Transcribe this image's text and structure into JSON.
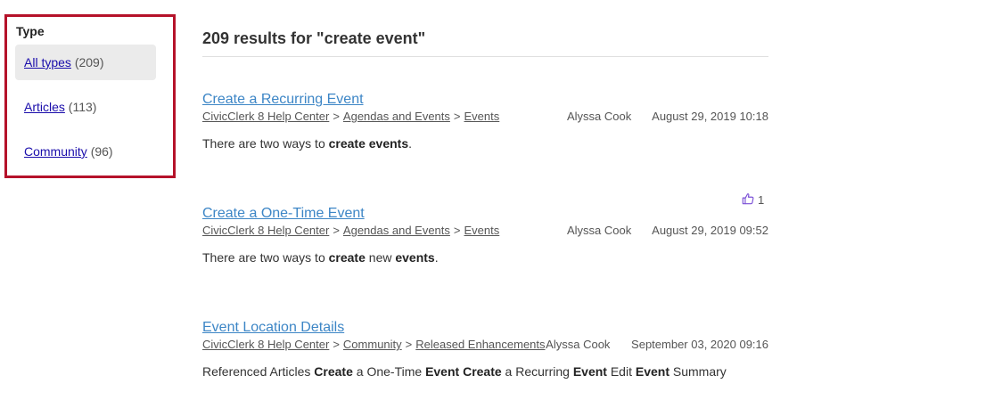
{
  "filters": {
    "title": "Type",
    "items": [
      {
        "label": "All types",
        "count": "(209)"
      },
      {
        "label": "Articles",
        "count": "(113)"
      },
      {
        "label": "Community",
        "count": "(96)"
      }
    ]
  },
  "results_heading": "209 results for \"create event\"",
  "results": [
    {
      "title": "Create a Recurring Event",
      "crumbs": [
        "CivicClerk 8 Help Center",
        "Agendas and Events",
        "Events"
      ],
      "author": "Alyssa Cook",
      "date": "August 29, 2019 10:18",
      "snippet_parts": [
        "There are two ways to ",
        "create events",
        "."
      ]
    },
    {
      "title": "Create a One-Time Event",
      "crumbs": [
        "CivicClerk 8 Help Center",
        "Agendas and Events",
        "Events"
      ],
      "author": "Alyssa Cook",
      "date": "August 29, 2019 09:52",
      "votes": "1",
      "snippet_parts": [
        "There are two ways to ",
        "create",
        " new ",
        "events",
        "."
      ]
    },
    {
      "title": "Event Location Details",
      "crumbs": [
        "CivicClerk 8 Help Center",
        "Community",
        "Released Enhancements"
      ],
      "author": "Alyssa Cook",
      "date": "September 03, 2020 09:16",
      "snippet_parts": [
        "Referenced Articles ",
        "Create",
        " a One-Time ",
        "Event",
        " ",
        "Create",
        " a Recurring ",
        "Event",
        " Edit ",
        "Event",
        " Summary"
      ]
    }
  ],
  "crumb_separator": ">",
  "colors": {
    "filter_border": "#b5122a",
    "link_blue": "#3d86c6",
    "vote_icon": "#7a4fd6"
  }
}
